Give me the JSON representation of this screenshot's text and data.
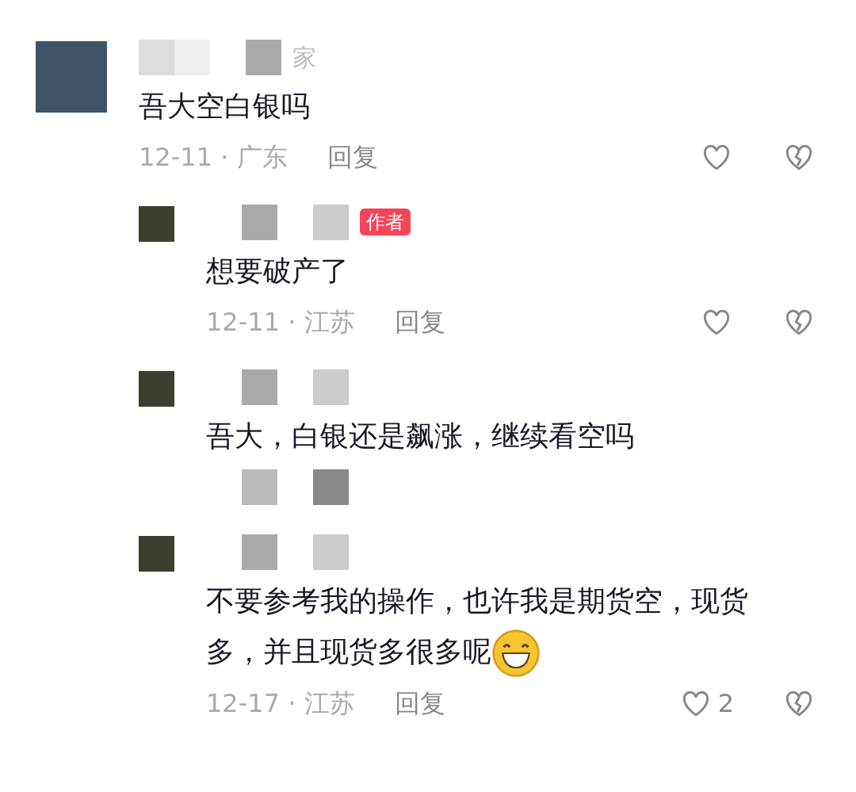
{
  "comments": [
    {
      "author_note": "家",
      "text": "吾大空白银吗",
      "date": "12-11 · 广东",
      "reply_label": "回复",
      "replies": [
        {
          "badge": "作者",
          "text": "想要破产了",
          "date": "12-11 · 江苏",
          "reply_label": "回复"
        },
        {
          "text": "吾大，白银还是飙涨，继续看空吗"
        },
        {
          "text": "不要参考我的操作，也许我是期货空，现货多，并且现货多很多呢",
          "emoji": true,
          "date": "12-17 · 江苏",
          "reply_label": "回复",
          "like_count": "2"
        }
      ]
    }
  ]
}
